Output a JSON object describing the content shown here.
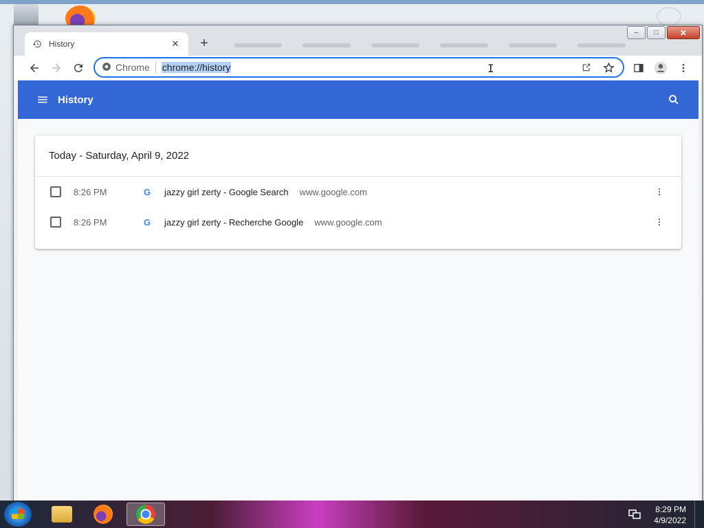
{
  "browser": {
    "tab": {
      "title": "History",
      "close": "✕"
    },
    "new_tab": "+",
    "address": {
      "site_label": "Chrome",
      "url": "chrome://history"
    }
  },
  "window_controls": {
    "minimize": "–",
    "maximize": "□",
    "close": "✕"
  },
  "history": {
    "app_title": "History",
    "group_title": "Today - Saturday, April 9, 2022",
    "entries": [
      {
        "time": "8:26 PM",
        "title": "jazzy girl zerty - Google Search",
        "domain": "www.google.com",
        "favicon": "G"
      },
      {
        "time": "8:26 PM",
        "title": "jazzy girl zerty - Recherche Google",
        "domain": "www.google.com",
        "favicon": "G"
      }
    ]
  },
  "taskbar": {
    "clock_time": "8:29 PM",
    "clock_date": "4/9/2022"
  },
  "colors": {
    "app_bar": "#3367d6",
    "accent": "#1a73e8",
    "page_bg": "#f8f9fa"
  },
  "icons": [
    "history-icon",
    "back-icon",
    "forward-icon",
    "reload-icon",
    "site-info-icon",
    "share-icon",
    "bookmark-star-icon",
    "side-panel-icon",
    "profile-icon",
    "kebab-menu-icon",
    "hamburger-icon",
    "search-icon",
    "google-favicon",
    "more-actions-icon"
  ]
}
